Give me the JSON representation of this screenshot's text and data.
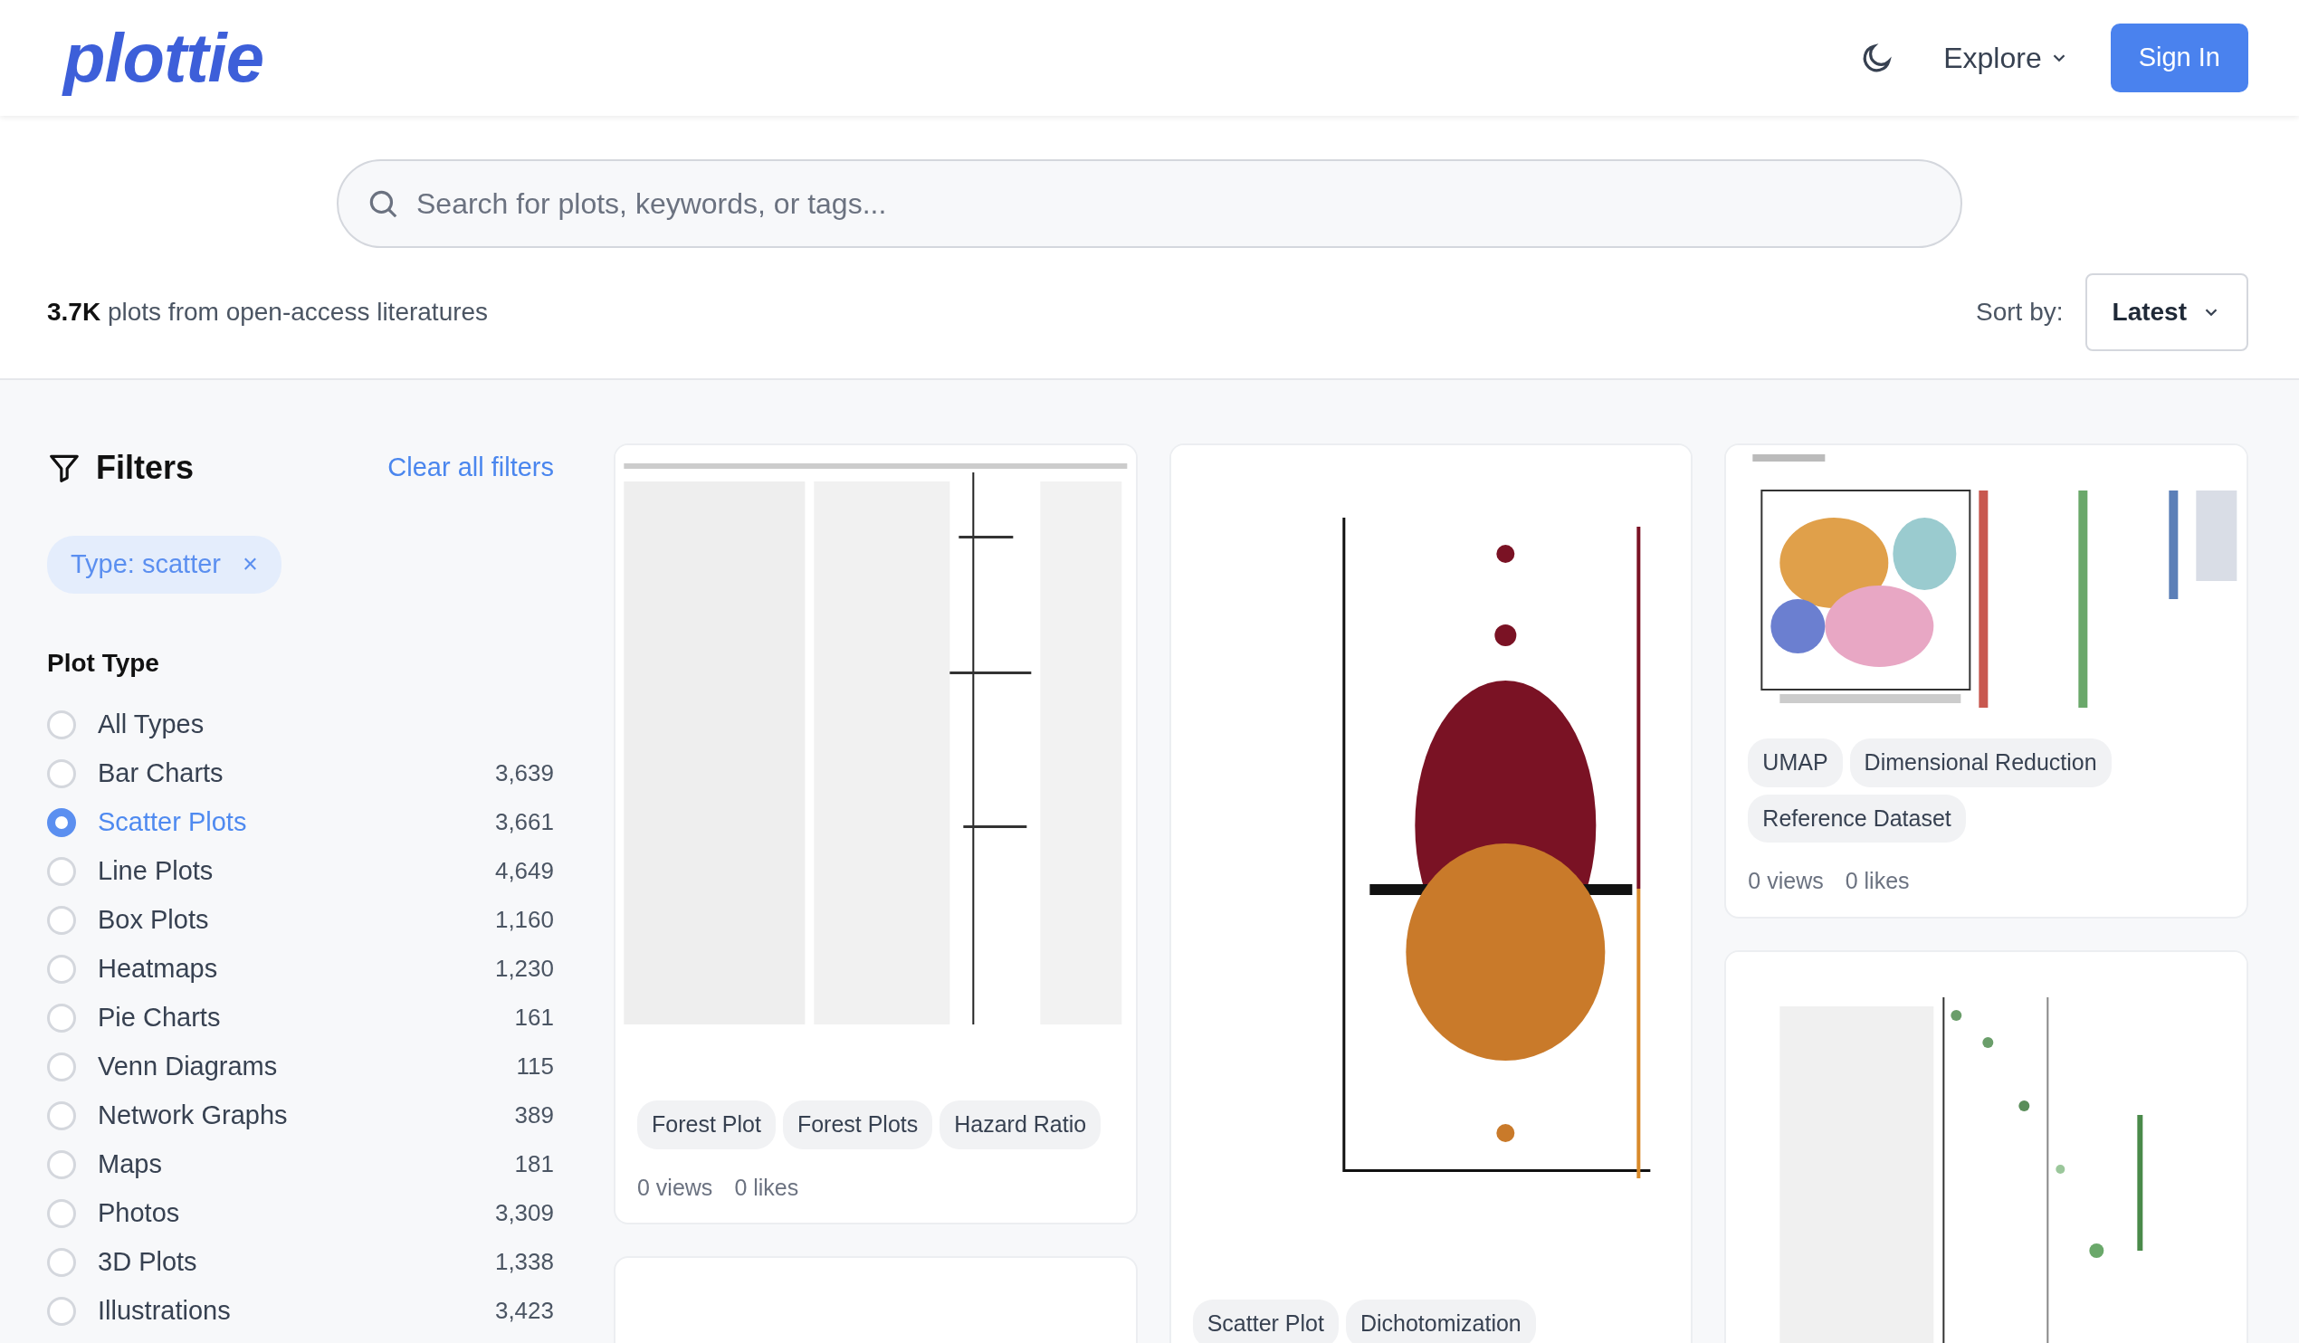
{
  "brand": "plottie",
  "nav": {
    "explore": "Explore",
    "sign_in": "Sign In"
  },
  "search": {
    "placeholder": "Search for plots, keywords, or tags..."
  },
  "summary": {
    "count": "3.7K",
    "text": "plots from open-access literatures"
  },
  "sort": {
    "label": "Sort by:",
    "value": "Latest"
  },
  "filters": {
    "title": "Filters",
    "clear": "Clear all filters",
    "active": [
      {
        "label": "Type: scatter",
        "remove": "×"
      }
    ],
    "section": "Plot Type",
    "options": [
      {
        "label": "All Types",
        "selected": false
      },
      {
        "label": "Bar Charts",
        "count": "3,639",
        "selected": false
      },
      {
        "label": "Scatter Plots",
        "count": "3,661",
        "selected": true
      },
      {
        "label": "Line Plots",
        "count": "4,649",
        "selected": false
      },
      {
        "label": "Box Plots",
        "count": "1,160",
        "selected": false
      },
      {
        "label": "Heatmaps",
        "count": "1,230",
        "selected": false
      },
      {
        "label": "Pie Charts",
        "count": "161",
        "selected": false
      },
      {
        "label": "Venn Diagrams",
        "count": "115",
        "selected": false
      },
      {
        "label": "Network Graphs",
        "count": "389",
        "selected": false
      },
      {
        "label": "Maps",
        "count": "181",
        "selected": false
      },
      {
        "label": "Photos",
        "count": "3,309",
        "selected": false
      },
      {
        "label": "3D Plots",
        "count": "1,338",
        "selected": false
      },
      {
        "label": "Illustrations",
        "count": "3,423",
        "selected": false
      }
    ]
  },
  "columns": [
    [
      {
        "image": {
          "kind": "picture"
        },
        "tags": [
          "Forest Plot",
          "Forest Plots",
          "Hazard Ratio"
        ],
        "views": "0 views",
        "likes": "0 likes"
      },
      {}
    ],
    [
      {
        "image": {
          "kind": "picture"
        },
        "tags": [
          "Scatter Plot",
          "Dichotomization"
        ]
      }
    ],
    [
      {
        "image": {
          "kind": "picture"
        },
        "tags": [
          "UMAP",
          "Dimensional Reduction",
          "Reference Dataset"
        ],
        "views": "0 views",
        "likes": "0 likes"
      },
      {
        "image": {
          "kind": "picture"
        }
      }
    ]
  ]
}
